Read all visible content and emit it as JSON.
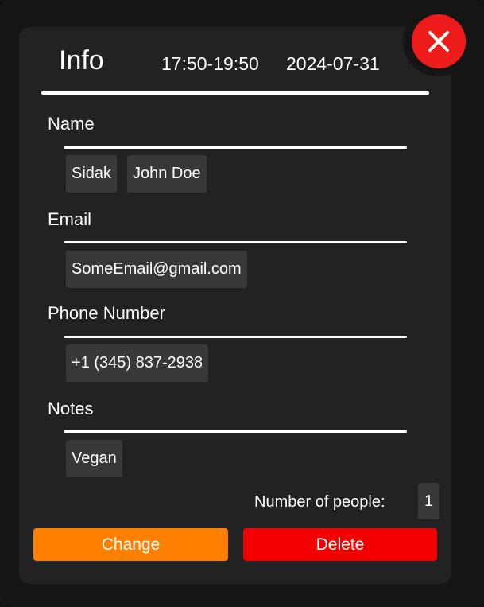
{
  "header": {
    "title": "Info",
    "time_range": "17:50-19:50",
    "date": "2024-07-31"
  },
  "close_button": {
    "icon": "close-icon"
  },
  "fields": {
    "name": {
      "label": "Name",
      "values": [
        "Sidak",
        "John Doe"
      ]
    },
    "email": {
      "label": "Email",
      "values": [
        "SomeEmail@gmail.com"
      ]
    },
    "phone": {
      "label": "Phone Number",
      "values": [
        "+1 (345) 837-2938"
      ]
    },
    "notes": {
      "label": "Notes",
      "values": [
        "Vegan"
      ]
    }
  },
  "people": {
    "label": "Number of people:",
    "value": "1"
  },
  "actions": {
    "change_label": "Change",
    "delete_label": "Delete"
  },
  "colors": {
    "background": "#151515",
    "card": "#222222",
    "chip": "#383838",
    "close": "#ee1b1b",
    "change": "#ff8000",
    "delete": "#f30000"
  }
}
